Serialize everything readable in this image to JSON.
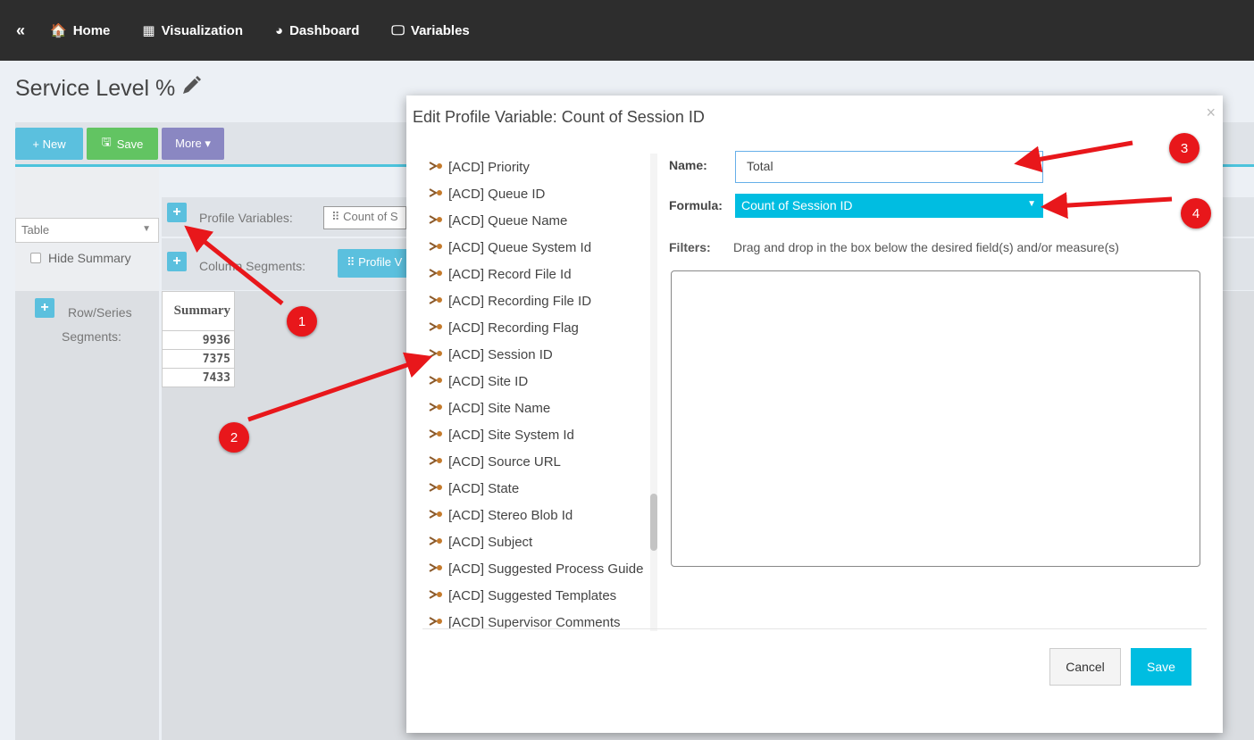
{
  "nav": {
    "collapse": "«",
    "items": [
      {
        "label": "Home",
        "icon": "home-icon",
        "glyph": "🏠"
      },
      {
        "label": "Visualization",
        "icon": "table-icon",
        "glyph": "▦"
      },
      {
        "label": "Dashboard",
        "icon": "dashboard-icon",
        "glyph": "◕"
      },
      {
        "label": "Variables",
        "icon": "monitor-icon",
        "glyph": "🖵"
      }
    ]
  },
  "page": {
    "title": "Service Level %",
    "toolbar": {
      "new_label": "+ New",
      "save_label": "Save",
      "more_label": "More ▾"
    },
    "view_select": "Table",
    "hide_summary": "Hide Summary",
    "profile_variables_label": "Profile Variables:",
    "profile_variables_chip": "⠿ Count of S",
    "column_segments_label": "Column Segments:",
    "column_segments_chip": "⠿ Profile V",
    "row_series_label_1": "Row/Series",
    "row_series_label_2": "Segments:",
    "summary_header": "Summary",
    "summary_values": [
      "9936",
      "7375",
      "7433"
    ]
  },
  "modal": {
    "title": "Edit Profile Variable: Count of Session ID",
    "close": "×",
    "fields": [
      "[ACD] Priority",
      "[ACD] Queue ID",
      "[ACD] Queue Name",
      "[ACD] Queue System Id",
      "[ACD] Record File Id",
      "[ACD] Recording File ID",
      "[ACD] Recording Flag",
      "[ACD] Session ID",
      "[ACD] Site ID",
      "[ACD] Site Name",
      "[ACD] Site System Id",
      "[ACD] Source URL",
      "[ACD] State",
      "[ACD] Stereo Blob Id",
      "[ACD] Subject",
      "[ACD] Suggested Process Guide",
      "[ACD] Suggested Templates",
      "[ACD] Supervisor Comments"
    ],
    "name_label": "Name:",
    "name_value": "Total",
    "formula_label": "Formula:",
    "formula_value": "Count of Session ID",
    "filters_label": "Filters:",
    "filters_hint": "Drag and drop in the box below the desired field(s) and/or measure(s)",
    "cancel_label": "Cancel",
    "save_label": "Save"
  },
  "annotations": {
    "badges": [
      "1",
      "2",
      "3",
      "4"
    ],
    "color": "#e8171b"
  }
}
